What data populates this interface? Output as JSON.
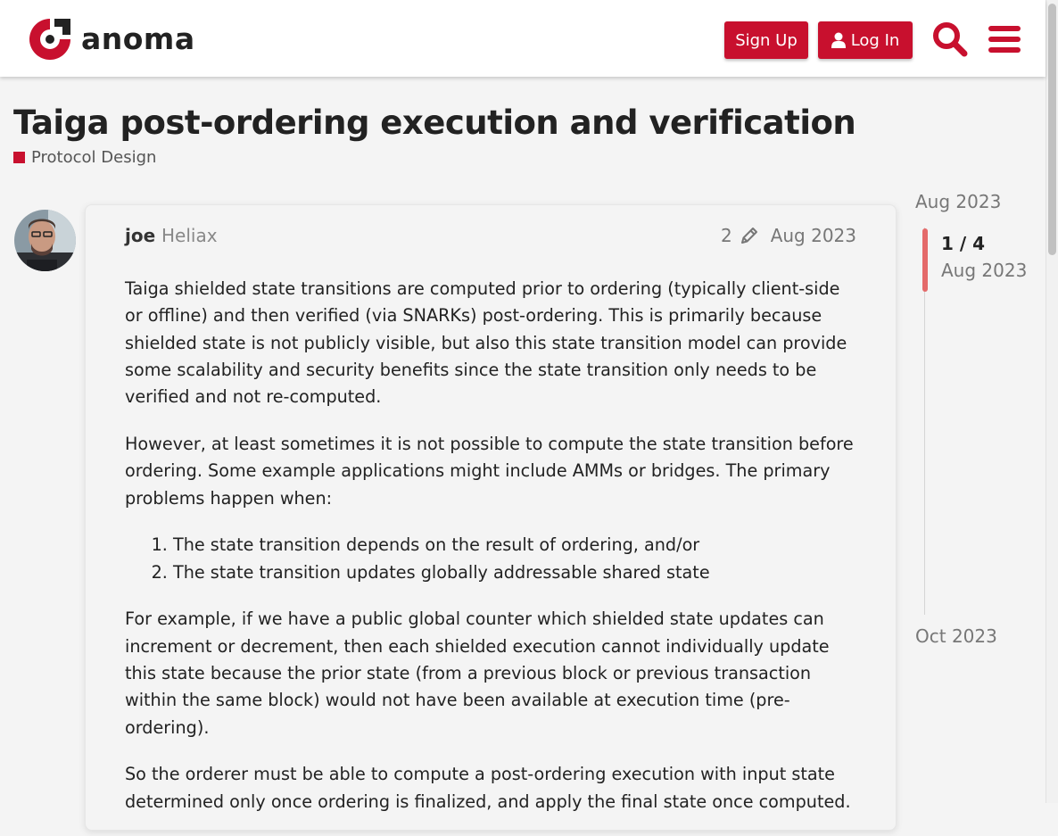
{
  "header": {
    "logo_text": "anoma",
    "signup_label": "Sign Up",
    "login_label": "Log In",
    "search_icon": "search-icon",
    "menu_icon": "hamburger-menu-icon",
    "brand_color": "#c8102e"
  },
  "topic": {
    "title": "Taiga post-ordering execution and verification",
    "category": "Protocol Design",
    "category_color": "#c8102e"
  },
  "post": {
    "username": "joe",
    "user_group": "Heliax",
    "edit_count": "2",
    "date": "Aug 2023",
    "paragraphs": [
      "Taiga shielded state transitions are computed prior to ordering (typically client-side or offline) and then verified (via SNARKs) post-ordering. This is primarily because shielded state is not publicly visible, but also this state transition model can provide some scalability and security benefits since the state transition only needs to be verified and not re-computed.",
      "However, at least sometimes it is not possible to compute the state transition before ordering. Some example applications might include AMMs or bridges. The primary problems happen when:"
    ],
    "list_items": [
      "The state transition depends on the result of ordering, and/or",
      "The state transition updates globally addressable shared state"
    ],
    "paragraphs_after": [
      "For example, if we have a public global counter which shielded state updates can increment or decrement, then each shielded execution cannot individually update this state because the prior state (from a previous block or previous transaction within the same block) would not have been available at execution time (pre-ordering).",
      "So the orderer must be able to compute a post-ordering execution with input state determined only once ordering is finalized, and apply the final state once computed."
    ]
  },
  "timeline": {
    "start_date": "Aug 2023",
    "position": "1 / 4",
    "position_date": "Aug 2023",
    "end_date": "Oct 2023"
  }
}
